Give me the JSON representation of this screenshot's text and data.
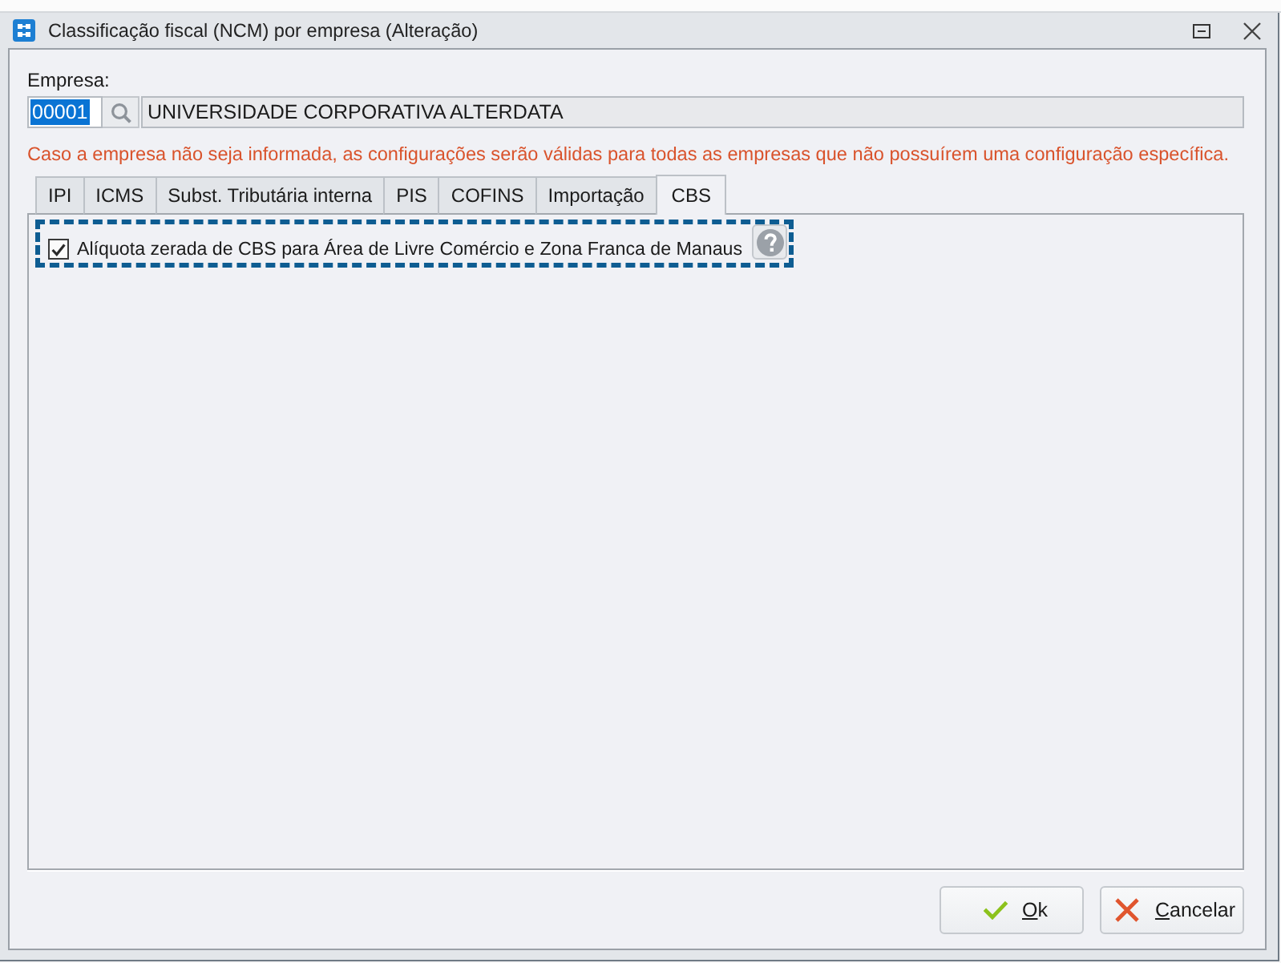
{
  "window": {
    "title": "Classificação fiscal (NCM) por empresa (Alteração)"
  },
  "empresa": {
    "label": "Empresa:",
    "code": {
      "value": "00001",
      "selected": true
    },
    "name": {
      "value": "UNIVERSIDADE CORPORATIVA ALTERDATA",
      "readonly": true
    }
  },
  "notice": "Caso a empresa não seja informada, as configurações serão válidas para todas as empresas que não possuírem uma configuração específica.",
  "tabs": [
    {
      "label": "IPI",
      "selected": false
    },
    {
      "label": "ICMS",
      "selected": false
    },
    {
      "label": "Subst. Tributária interna",
      "selected": false
    },
    {
      "label": "PIS",
      "selected": false
    },
    {
      "label": "COFINS",
      "selected": false
    },
    {
      "label": "Importação",
      "selected": false
    },
    {
      "label": "CBS",
      "selected": true
    }
  ],
  "options": [
    {
      "label": "Alíquota zerada de CBS para Área de Livre Comércio e Zona Franca de Manaus",
      "checked": true,
      "focused": true,
      "help": true
    }
  ],
  "buttons": [
    {
      "label": "Ok",
      "kind": "ok",
      "mnemonic": true
    },
    {
      "label": "Cancelar",
      "kind": "cancel",
      "mnemonic": true
    }
  ]
}
